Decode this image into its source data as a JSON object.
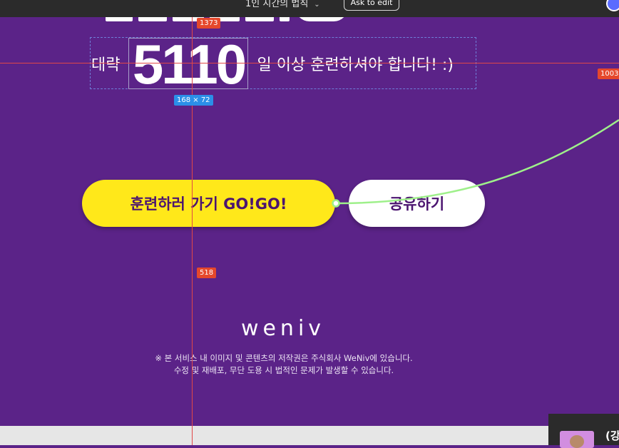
{
  "topbar": {
    "dropdown_label": "1인 시간의 법칙",
    "dropdown_icon": "chevron-down-icon",
    "ask_button_label": "Ask to edit",
    "avatar_icon": "user-avatar"
  },
  "result": {
    "prefix": "대략",
    "days": "5110",
    "suffix": "일 이상 훈련하셔야 합니다! :)"
  },
  "editor_overlay": {
    "measure_top": "1373",
    "measure_right": "1003",
    "measure_mid": "518",
    "size_badge": "168 × 72",
    "guide_color": "#e04848",
    "connector_color": "#9ef08a"
  },
  "actions": {
    "train_label": "훈련하러 가기 GO!GO!",
    "share_label": "공유하기"
  },
  "footer": {
    "logo": "weniv",
    "copyright_line1": "※ 본 서비스 내 이미지 및 콘텐츠의 저작권은 주식회사 WeNiv에 있습니다.",
    "copyright_line2": "수정 및 재배포, 무단 도용 시 법적인 문제가 발생할 수 있습니다."
  },
  "popup": {
    "title": "(강"
  },
  "colors": {
    "background": "#5b2388",
    "accent_yellow": "#ffe81a",
    "text_purple": "#4b1470"
  }
}
